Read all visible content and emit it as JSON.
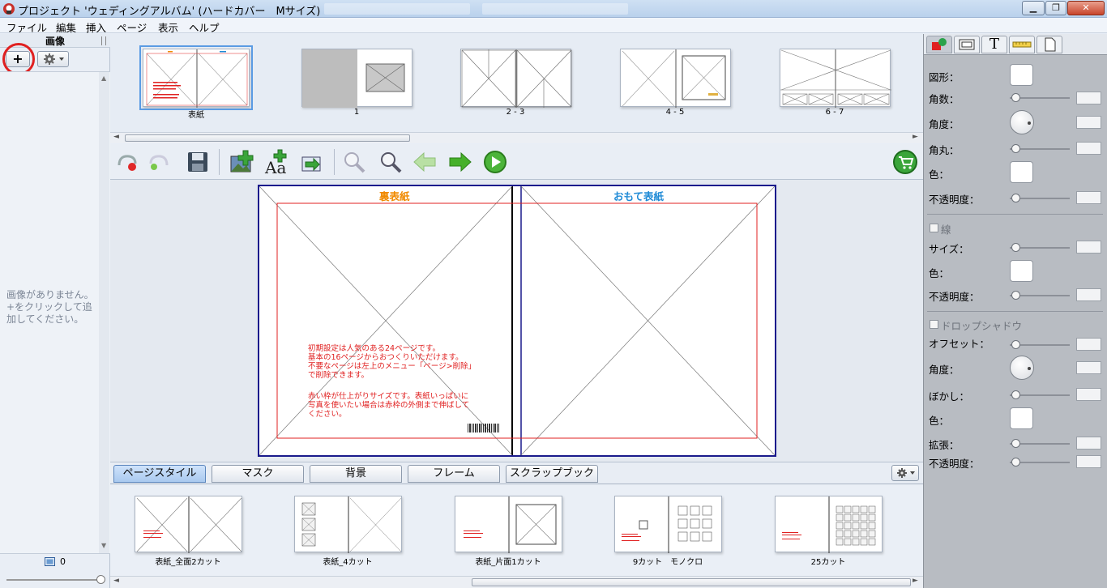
{
  "window": {
    "title": "プロジェクト 'ウェディングアルバム' (ハードカバー　Mサイズ)"
  },
  "menu": [
    "ファイル",
    "編集",
    "挿入",
    "ページ",
    "表示",
    "ヘルプ"
  ],
  "left_panel": {
    "header": "画像",
    "add_label": "+",
    "empty_message": "画像がありません。+をクリックして追加してください。",
    "count": "0"
  },
  "page_strip": [
    {
      "label": "表紙"
    },
    {
      "label": "1"
    },
    {
      "label": "2 - 3"
    },
    {
      "label": "4 - 5"
    },
    {
      "label": "6 - 7"
    }
  ],
  "spread": {
    "back_title": "裏表紙",
    "front_title": "おもて表紙",
    "note1": "初期設定は人気のある24ページです。\n基本の16ページからおつくりいただけます。\n不要なページは左上のメニュー「ページ>削除」\nで削除できます。",
    "note2": "赤い枠が仕上がりサイズです。表紙いっぱいに\n写真を使いたい場合は赤枠の外側まで伸ばして\nください。"
  },
  "tabs": [
    "ページスタイル",
    "マスク",
    "背景",
    "フレーム",
    "スクラップブック"
  ],
  "styles": [
    {
      "label": "表紙_全面2カット"
    },
    {
      "label": "表紙_4カット"
    },
    {
      "label": "表紙_片面1カット"
    },
    {
      "label": "9カット　モノクロ"
    },
    {
      "label": "25カット"
    }
  ],
  "properties": {
    "shape": "図形：",
    "corners": "角数：",
    "angle": "角度：",
    "round": "角丸：",
    "color": "色：",
    "opacity": "不透明度：",
    "line": "線",
    "size": "サイズ：",
    "line_color": "色：",
    "line_opacity": "不透明度：",
    "dropshadow": "ドロップシャドウ",
    "offset": "オフセット：",
    "shadow_angle": "角度：",
    "blur": "ぼかし：",
    "shadow_color": "色：",
    "expand": "拡張：",
    "shadow_opacity": "不透明度："
  },
  "colors": {
    "accent_blue": "#1a1a8c",
    "cover_back_title": "#f08a00",
    "cover_front_title": "#1e8ad6",
    "guide_red": "#e02020"
  }
}
